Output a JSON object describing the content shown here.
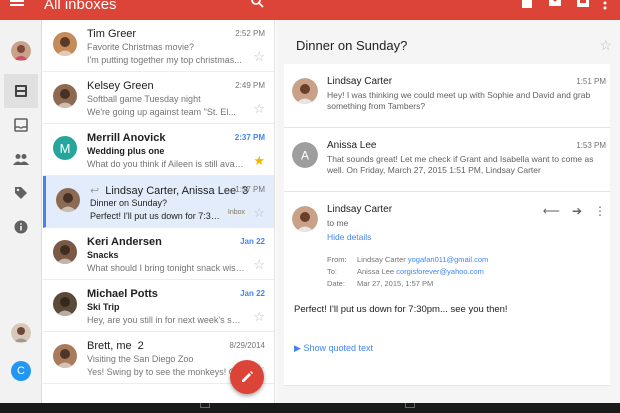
{
  "appbar": {
    "title": "All inboxes",
    "actions": [
      "archive-icon",
      "mail-icon",
      "move-icon",
      "more-icon"
    ]
  },
  "rail": {
    "items": [
      "account-avatar",
      "inbox-all-icon",
      "inbox-icon",
      "people-icon",
      "label-icon",
      "info-icon"
    ],
    "bottom_account_letter": "C"
  },
  "conversations": [
    {
      "sender": "Tim Greer",
      "time": "2:52 PM",
      "subject": "Favorite Christmas movie?",
      "snippet": "I'm putting together my top christmas...",
      "sender_bold": false,
      "time_blue": false,
      "starred": false,
      "avatar_color": "#c58b5a"
    },
    {
      "sender": "Kelsey Green",
      "time": "2:49 PM",
      "subject": "Softball game Tuesday night",
      "snippet": "We're going up against team \"St. El...",
      "sender_bold": false,
      "time_blue": false,
      "starred": false,
      "avatar_color": "#8f6a52"
    },
    {
      "sender": "Merrill Anovick",
      "time": "2:37 PM",
      "subject": "Wedding plus one",
      "snippet": "What do you think if Aileen is still available...",
      "sender_bold": true,
      "time_blue": true,
      "starred": true,
      "avatar_letter": "M",
      "avatar_color": "#26a69a"
    },
    {
      "sender": "Lindsay Carter, Anissa Lee",
      "count": "3",
      "time": "1:57 PM",
      "subject": "Dinner on Sunday?",
      "snippet": "Perfect! I'll put us down for 7:30pm...",
      "badge": "Inbox",
      "sender_bold": false,
      "time_blue": false,
      "starred": false,
      "selected": true,
      "avatar_color": "#8c6b55"
    },
    {
      "sender": "Keri Andersen",
      "time": "Jan 22",
      "subject": "Snacks",
      "snippet": "What should I bring tonight snack wise? I'm...",
      "sender_bold": true,
      "time_blue": true,
      "starred": false,
      "avatar_color": "#7a5a45"
    },
    {
      "sender": "Michael Potts",
      "time": "Jan 22",
      "subject": "Ski Trip",
      "snippet": "Hey, are you still in for next week's ski trip?...",
      "sender_bold": true,
      "time_blue": true,
      "starred": false,
      "avatar_color": "#5b4a3a"
    },
    {
      "sender": "Brett, me",
      "count": "2",
      "time": "8/29/2014",
      "subject": "Visiting the San Diego Zoo",
      "snippet": "Yes! Swing by to see the monkeys! On Fri...",
      "sender_bold": false,
      "time_blue": false,
      "starred": false,
      "avatar_color": "#a77b5c"
    }
  ],
  "detail": {
    "subject": "Dinner on Sunday?",
    "messages": [
      {
        "from": "Lindsay Carter",
        "time": "1:51 PM",
        "body": "Hey! I was thinking we could meet up with Sophie and David and grab something from Tambers?",
        "avatar_color": "#8c6b55"
      },
      {
        "from": "Anissa Lee",
        "time": "1:53 PM",
        "body": "That sounds great! Let me check if Grant and Isabella want to come as well. On Friday, March 27, 2015 1:51 PM, Lindsay Carter",
        "avatar_letter": "A",
        "avatar_color": "#9e9e9e"
      }
    ],
    "expanded": {
      "from": "Lindsay Carter",
      "to": "to me",
      "hide_details": "Hide details",
      "meta": {
        "from_label": "From:",
        "from_name": "Lindsay Carter",
        "from_email": "yogafan011@gmail.com",
        "to_label": "To:",
        "to_name": "Anissa Lee",
        "to_email": "corgisforever@yahoo.com",
        "date_label": "Date:",
        "date_value": "Mar 27, 2015, 1:57 PM"
      },
      "body": "Perfect! I'll put us down for 7:30pm... see you then!",
      "show_quoted": "Show quoted text"
    }
  },
  "colors": {
    "brand_red": "#db4437",
    "accent_blue": "#4285f4",
    "star_yellow": "#f4b400"
  }
}
